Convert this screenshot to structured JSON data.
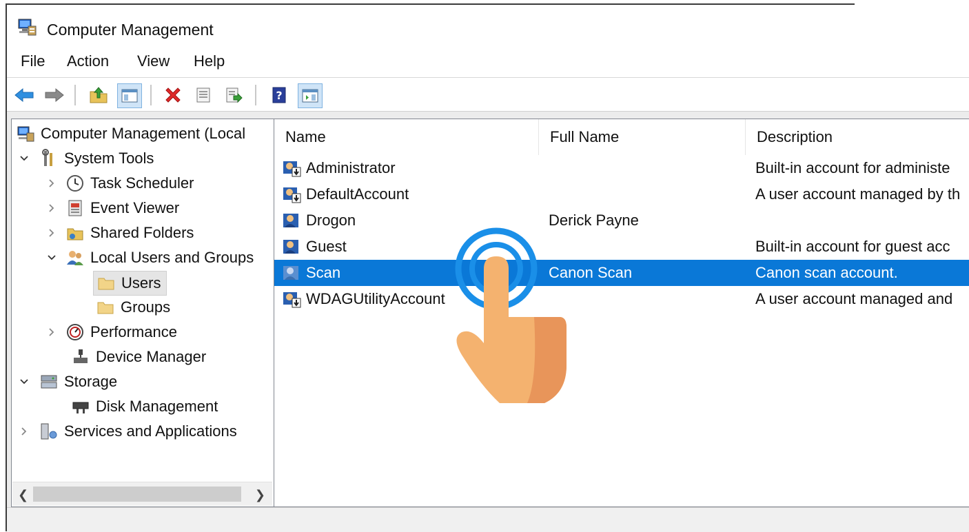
{
  "window": {
    "title": "Computer Management"
  },
  "menu": [
    "File",
    "Action",
    "View",
    "Help"
  ],
  "toolbar": {
    "icons": [
      "back-arrow-icon",
      "forward-arrow-icon",
      "up-folder-icon",
      "show-hide-console-tree-icon",
      "delete-icon",
      "properties-icon",
      "export-list-icon",
      "help-icon",
      "show-hide-action-pane-icon"
    ]
  },
  "tree": {
    "root": "Computer Management (Local",
    "system_tools": "System Tools",
    "task_scheduler": "Task Scheduler",
    "event_viewer": "Event Viewer",
    "shared_folders": "Shared Folders",
    "local_users": "Local Users and Groups",
    "users": "Users",
    "groups": "Groups",
    "performance": "Performance",
    "device_manager": "Device Manager",
    "storage": "Storage",
    "disk_management": "Disk Management",
    "services": "Services and Applications"
  },
  "list": {
    "columns": [
      "Name",
      "Full Name",
      "Description"
    ],
    "rows": [
      {
        "name": "Administrator",
        "full_name": "",
        "description": "Built-in account for administe"
      },
      {
        "name": "DefaultAccount",
        "full_name": "",
        "description": "A user account managed by th"
      },
      {
        "name": "Drogon",
        "full_name": "Derick Payne",
        "description": ""
      },
      {
        "name": "Guest",
        "full_name": "",
        "description": "Built-in account for guest acc"
      },
      {
        "name": "Scan",
        "full_name": "Canon Scan",
        "description": "Canon scan account."
      },
      {
        "name": "WDAGUtilityAccount",
        "full_name": "",
        "description": "A user account managed and"
      }
    ],
    "selected_row": 4
  },
  "colors": {
    "selection": "#0a78d7",
    "hand": "#f4b26f"
  }
}
